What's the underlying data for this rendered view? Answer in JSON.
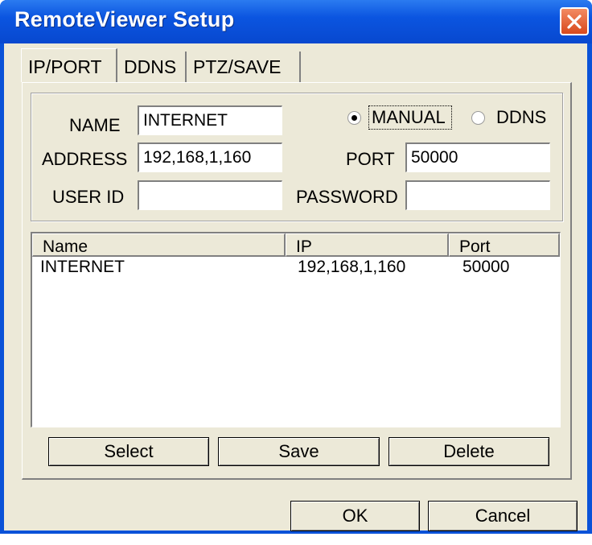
{
  "window": {
    "title": "RemoteViewer Setup"
  },
  "tabs": [
    {
      "label": "IP/PORT",
      "active": true
    },
    {
      "label": "DDNS",
      "active": false
    },
    {
      "label": "PTZ/SAVE",
      "active": false
    }
  ],
  "form": {
    "name_label": "NAME",
    "name_value": "INTERNET",
    "address_label": "ADDRESS",
    "address_value": "192,168,1,160",
    "userid_label": "USER ID",
    "userid_value": "",
    "port_label": "PORT",
    "port_value": "50000",
    "password_label": "PASSWORD",
    "password_value": "",
    "radio_manual_label": "MANUAL",
    "radio_ddns_label": "DDNS",
    "selected_mode": "MANUAL"
  },
  "list": {
    "columns": [
      "Name",
      "IP",
      "Port"
    ],
    "rows": [
      [
        "INTERNET",
        "192,168,1,160",
        "50000"
      ]
    ]
  },
  "buttons": {
    "select": "Select",
    "save": "Save",
    "delete": "Delete",
    "ok": "OK",
    "cancel": "Cancel"
  },
  "colors": {
    "titlebar": "#0b55e0",
    "dialog_bg": "#ece9d8",
    "close_button": "#d8481c"
  },
  "icons": {
    "close": "close-icon",
    "radio": "radio-icon"
  }
}
